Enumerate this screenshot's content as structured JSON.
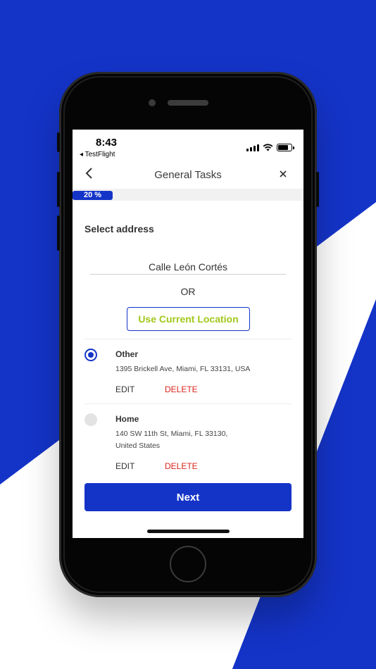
{
  "colors": {
    "brand_blue": "#1434c8",
    "accent_green": "#a3c71b",
    "delete_red": "#d9261c"
  },
  "status_bar": {
    "time": "8:43",
    "back_app": "◂ TestFlight"
  },
  "nav": {
    "back_icon": "chevron-left-icon",
    "title": "General Tasks",
    "close_icon": "close-icon"
  },
  "progress": {
    "value": 0.2,
    "label": "20 %"
  },
  "form": {
    "section_title": "Select address",
    "address_value": "Calle León Cortés",
    "or_label": "OR",
    "use_location_label": "Use Current Location"
  },
  "addresses": [
    {
      "name": "Other",
      "line": "1395 Brickell Ave, Miami, FL 33131, USA",
      "selected": true,
      "edit": "EDIT",
      "delete": "DELETE"
    },
    {
      "name": "Home",
      "line": "140 SW 11th St, Miami, FL  33130, United States",
      "selected": false,
      "edit": "EDIT",
      "delete": "DELETE"
    }
  ],
  "next_label": "Next"
}
